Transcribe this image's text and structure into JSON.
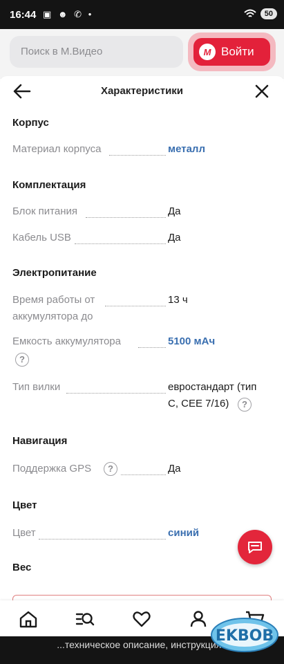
{
  "status_bar": {
    "time": "16:44",
    "icons_left": "▣ ☻ ✆ •",
    "signal": "◉ ▲",
    "battery": "50"
  },
  "header": {
    "search_placeholder": "Поиск в М.Видео",
    "login_logo": "М",
    "login_label": "Войти"
  },
  "sheet": {
    "title": "Характеристики"
  },
  "sections": {
    "body": {
      "title": "Корпус",
      "material_name": "Материал корпуса",
      "material_value": "металл"
    },
    "kit": {
      "title": "Комплектация",
      "psu_name": "Блок питания",
      "psu_value": "Да",
      "usb_name": "Кабель USB",
      "usb_value": "Да"
    },
    "power": {
      "title": "Электропитание",
      "runtime_name_1": "Время работы от",
      "runtime_name_2": "аккумулятора до",
      "runtime_value": "13 ч",
      "capacity_name": "Емкость аккумулятора",
      "capacity_value": "5100 мАч",
      "plug_name": "Тип вилки",
      "plug_value_1": "евростандарт (тип",
      "plug_value_2": "C, CEE 7/16)"
    },
    "navigation": {
      "title": "Навигация",
      "gps_name": "Поддержка GPS",
      "gps_value": "Да"
    },
    "color": {
      "title": "Цвет",
      "color_name": "Цвет",
      "color_value": "синий"
    },
    "weight": {
      "title": "Вес"
    }
  },
  "help_glyph": "?",
  "bottom_caption": "...техническое описание, инструкция -",
  "watermark": "EKBOB",
  "colors": {
    "accent_red": "#e3213a",
    "link_blue": "#3a6fb0",
    "muted_text": "#8b8b8f"
  },
  "icons": [
    "back-arrow-icon",
    "close-icon",
    "help-icon",
    "chat-icon",
    "home-icon",
    "catalog-search-icon",
    "heart-icon",
    "profile-icon",
    "cart-icon"
  ]
}
